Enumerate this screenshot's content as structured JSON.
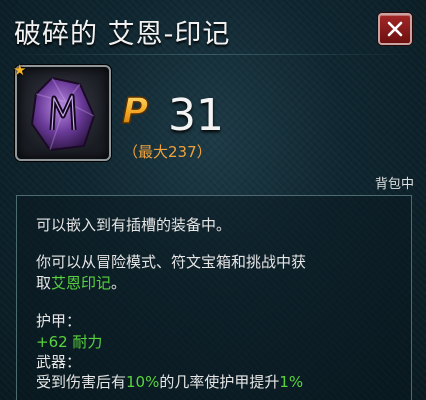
{
  "title": "破碎的 艾恩-印记",
  "item": {
    "icon": "purple-rune-stone-icon",
    "rarity_mark": "★"
  },
  "price": {
    "icon": "p-currency-icon",
    "letter": "P",
    "value": "31",
    "max_label": "（最大237）"
  },
  "location": "背包中",
  "description": {
    "line1": "可以嵌入到有插槽的装备中。",
    "line2": "你可以从冒险模式、符文宝箱和挑战中获",
    "line3_prefix": "取",
    "line3_highlight": "艾恩印记",
    "line3_suffix": "。"
  },
  "stats": {
    "armor_label": "护甲：",
    "armor_value": "+62 耐力",
    "weapon_label": "武器：",
    "weapon_prefix": "受到伤害后有",
    "weapon_chance": "10%",
    "weapon_middle": "的几率使护甲提升",
    "weapon_amount": "1%"
  },
  "colors": {
    "highlight_green": "#59d33f",
    "max_orange": "#f0a23a",
    "close_red": "#8e1a1a",
    "star_gold": "#f5b325"
  }
}
